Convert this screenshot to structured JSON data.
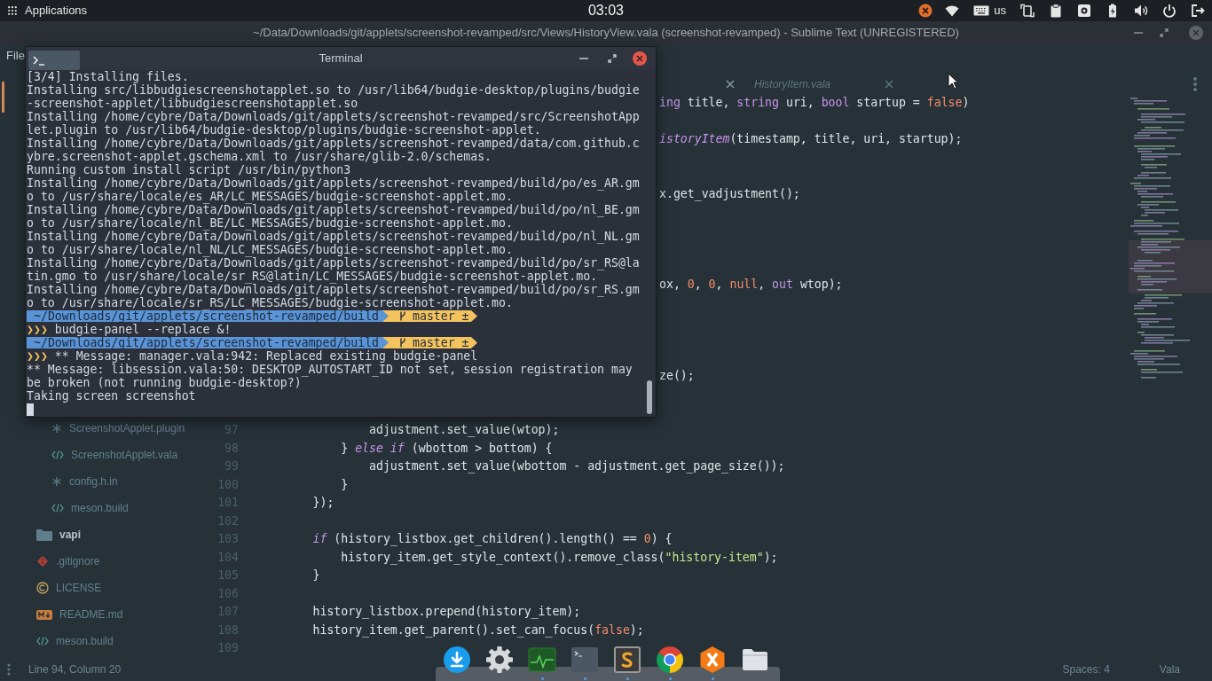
{
  "top_panel": {
    "menu_label": "Applications",
    "clock": "03:03",
    "keyboard_layout": "us"
  },
  "window": {
    "title": "~/Data/Downloads/git/applets/screenshot-revamped/src/Views/HistoryView.vala (screenshot-revamped) - Sublime Text (UNREGISTERED)",
    "menu": [
      "File"
    ]
  },
  "terminal": {
    "title": "Terminal",
    "lines": [
      {
        "kind": "output",
        "text": "[3/4] Installing files."
      },
      {
        "kind": "output",
        "text": "Installing src/libbudgiescreenshotapplet.so to /usr/lib64/budgie-desktop/plugins/budgie"
      },
      {
        "kind": "output",
        "text": "-screenshot-applet/libbudgiescreenshotapplet.so"
      },
      {
        "kind": "output",
        "text": "Installing /home/cybre/Data/Downloads/git/applets/screenshot-revamped/src/ScreenshotApp"
      },
      {
        "kind": "output",
        "text": "let.plugin to /usr/lib64/budgie-desktop/plugins/budgie-screenshot-applet."
      },
      {
        "kind": "output",
        "text": "Installing /home/cybre/Data/Downloads/git/applets/screenshot-revamped/data/com.github.c"
      },
      {
        "kind": "output",
        "text": "ybre.screenshot-applet.gschema.xml to /usr/share/glib-2.0/schemas."
      },
      {
        "kind": "output",
        "text": "Running custom install script /usr/bin/python3"
      },
      {
        "kind": "output",
        "text": "Installing /home/cybre/Data/Downloads/git/applets/screenshot-revamped/build/po/es_AR.gm"
      },
      {
        "kind": "output",
        "text": "o to /usr/share/locale/es_AR/LC_MESSAGES/budgie-screenshot-applet.mo."
      },
      {
        "kind": "output",
        "text": "Installing /home/cybre/Data/Downloads/git/applets/screenshot-revamped/build/po/nl_BE.gm"
      },
      {
        "kind": "output",
        "text": "o to /usr/share/locale/nl_BE/LC_MESSAGES/budgie-screenshot-applet.mo."
      },
      {
        "kind": "output",
        "text": "Installing /home/cybre/Data/Downloads/git/applets/screenshot-revamped/build/po/nl_NL.gm"
      },
      {
        "kind": "output",
        "text": "o to /usr/share/locale/nl_NL/LC_MESSAGES/budgie-screenshot-applet.mo."
      },
      {
        "kind": "output",
        "text": "Installing /home/cybre/Data/Downloads/git/applets/screenshot-revamped/build/po/sr_RS@la"
      },
      {
        "kind": "output",
        "text": "tin.gmo to /usr/share/locale/sr_RS@latin/LC_MESSAGES/budgie-screenshot-applet.mo."
      },
      {
        "kind": "output",
        "text": "Installing /home/cybre/Data/Downloads/git/applets/screenshot-revamped/build/po/sr_RS.gm"
      },
      {
        "kind": "output",
        "text": "o to /usr/share/locale/sr_RS/LC_MESSAGES/budgie-screenshot-applet.mo."
      },
      {
        "kind": "prompt",
        "path": "~/Downloads/git/applets/screenshot-revamped/build",
        "branch": "master ±"
      },
      {
        "kind": "command",
        "symbol": "❯❯❯",
        "text": "budgie-panel --replace &!"
      },
      {
        "kind": "prompt",
        "path": "~/Downloads/git/applets/screenshot-revamped/build",
        "branch": "master ±"
      },
      {
        "kind": "command",
        "symbol": "❯❯❯",
        "text": "** Message: manager.vala:942: Replaced existing budgie-panel"
      },
      {
        "kind": "output",
        "text": "** Message: libsession.vala:50: DESKTOP_AUTOSTART_ID not set, session registration may"
      },
      {
        "kind": "output",
        "text": "be broken (not running budgie-desktop?)"
      },
      {
        "kind": "output",
        "text": "Taking screen screenshot"
      },
      {
        "kind": "cursor"
      }
    ]
  },
  "sidebar": {
    "tree": [
      {
        "children": [
          {
            "label": "ScreenshotApplet.plugin",
            "kind": "text"
          },
          {
            "label": "ScreenshotApplet.vala",
            "kind": "code"
          },
          {
            "label": "config.h.in",
            "kind": "text"
          },
          {
            "label": "meson.build",
            "kind": "code"
          }
        ]
      },
      {
        "label": "vapi",
        "kind": "folder"
      },
      {
        "label": ".gitignore",
        "kind": "git"
      },
      {
        "label": "LICENSE",
        "kind": "license"
      },
      {
        "label": "README.md",
        "kind": "markdown"
      },
      {
        "label": "meson.build",
        "kind": "code"
      }
    ]
  },
  "tabs": [
    {
      "selected": true
    },
    {
      "label": "HistoryItem.vala",
      "selected": false
    }
  ],
  "editor": {
    "lines": [
      {
        "kind": "partial",
        "tokens": [
          {
            "text": "ing",
            "kind": "storage"
          },
          {
            "text": " title, ",
            "kind": "plain"
          },
          {
            "text": "string",
            "kind": "storage"
          },
          {
            "text": " uri, ",
            "kind": "plain"
          },
          {
            "text": "bool",
            "kind": "storage"
          },
          {
            "text": " startup = ",
            "kind": "plain"
          },
          {
            "text": "false",
            "kind": "constant"
          },
          {
            "text": ")",
            "kind": "plain"
          }
        ]
      },
      {
        "kind": "blank"
      },
      {
        "kind": "partial",
        "tokens": [
          {
            "text": "istoryItem",
            "kind": "class"
          },
          {
            "text": "(timestamp, title, uri, startup);",
            "kind": "plain"
          }
        ]
      },
      {
        "kind": "blank"
      },
      {
        "kind": "blank"
      },
      {
        "kind": "partial",
        "tokens": [
          {
            "text": "x.get_vadjustment();",
            "kind": "plain"
          }
        ]
      },
      {
        "kind": "blank"
      },
      {
        "kind": "blank"
      },
      {
        "kind": "blank"
      },
      {
        "kind": "blank"
      },
      {
        "kind": "partial",
        "tokens": [
          {
            "text": "ox, ",
            "kind": "plain"
          },
          {
            "text": "0",
            "kind": "constant"
          },
          {
            "text": ", ",
            "kind": "plain"
          },
          {
            "text": "0",
            "kind": "constant"
          },
          {
            "text": ", ",
            "kind": "plain"
          },
          {
            "text": "null",
            "kind": "constant"
          },
          {
            "text": ", ",
            "kind": "plain"
          },
          {
            "text": "out",
            "kind": "storage"
          },
          {
            "text": " wtop);",
            "kind": "plain"
          }
        ]
      },
      {
        "kind": "blank"
      },
      {
        "kind": "blank"
      },
      {
        "kind": "blank"
      },
      {
        "kind": "blank"
      },
      {
        "kind": "partial",
        "tokens": [
          {
            "text": "ze();",
            "kind": "plain"
          }
        ]
      },
      {
        "kind": "blank"
      },
      {
        "kind": "blank"
      },
      {
        "kind": "numbered",
        "number": "97",
        "tokens": [
          {
            "text": "                adjustment.set_value(wtop);",
            "kind": "plain"
          }
        ]
      },
      {
        "kind": "numbered",
        "number": "98",
        "tokens": [
          {
            "text": "            } ",
            "kind": "plain"
          },
          {
            "text": "else if",
            "kind": "keyword"
          },
          {
            "text": " (wbottom > bottom) {",
            "kind": "plain"
          }
        ]
      },
      {
        "kind": "numbered",
        "number": "99",
        "tokens": [
          {
            "text": "                adjustment.set_value(wbottom - adjustment.get_page_size());",
            "kind": "plain"
          }
        ]
      },
      {
        "kind": "numbered",
        "number": "100",
        "tokens": [
          {
            "text": "            }",
            "kind": "plain"
          }
        ]
      },
      {
        "kind": "numbered",
        "number": "101",
        "tokens": [
          {
            "text": "        });",
            "kind": "plain"
          }
        ]
      },
      {
        "kind": "numbered",
        "number": "102"
      },
      {
        "kind": "numbered",
        "number": "103",
        "tokens": [
          {
            "text": "        if",
            "kind": "keyword"
          },
          {
            "text": " (history_listbox.get_children().length() == ",
            "kind": "plain"
          },
          {
            "text": "0",
            "kind": "constant"
          },
          {
            "text": ") {",
            "kind": "plain"
          }
        ]
      },
      {
        "kind": "numbered",
        "number": "104",
        "tokens": [
          {
            "text": "            history_item.get_style_context().remove_class(",
            "kind": "plain"
          },
          {
            "text": "\"history-item\"",
            "kind": "string"
          },
          {
            "text": ");",
            "kind": "plain"
          }
        ]
      },
      {
        "kind": "numbered",
        "number": "105",
        "tokens": [
          {
            "text": "        }",
            "kind": "plain"
          }
        ]
      },
      {
        "kind": "numbered",
        "number": "106"
      },
      {
        "kind": "numbered",
        "number": "107",
        "tokens": [
          {
            "text": "        history_listbox.prepend(history_item);",
            "kind": "plain"
          }
        ]
      },
      {
        "kind": "numbered",
        "number": "108",
        "tokens": [
          {
            "text": "        history_item.get_parent().set_can_focus(",
            "kind": "plain"
          },
          {
            "text": "false",
            "kind": "constant"
          },
          {
            "text": ");",
            "kind": "plain"
          }
        ]
      },
      {
        "kind": "numbered",
        "number": "109"
      }
    ]
  },
  "status_bar": {
    "position": "Line 94, Column 20",
    "indentation": "Spaces: 4",
    "syntax": "Vala"
  },
  "dock": {
    "items": [
      {
        "kind": "download",
        "running": false
      },
      {
        "kind": "settings",
        "running": false
      },
      {
        "kind": "monitor",
        "running": true
      },
      {
        "kind": "terminal",
        "running": true
      },
      {
        "kind": "editor",
        "running": true
      },
      {
        "kind": "browser",
        "running": true
      },
      {
        "kind": "hexagon",
        "running": true
      },
      {
        "kind": "files",
        "running": false
      }
    ]
  }
}
